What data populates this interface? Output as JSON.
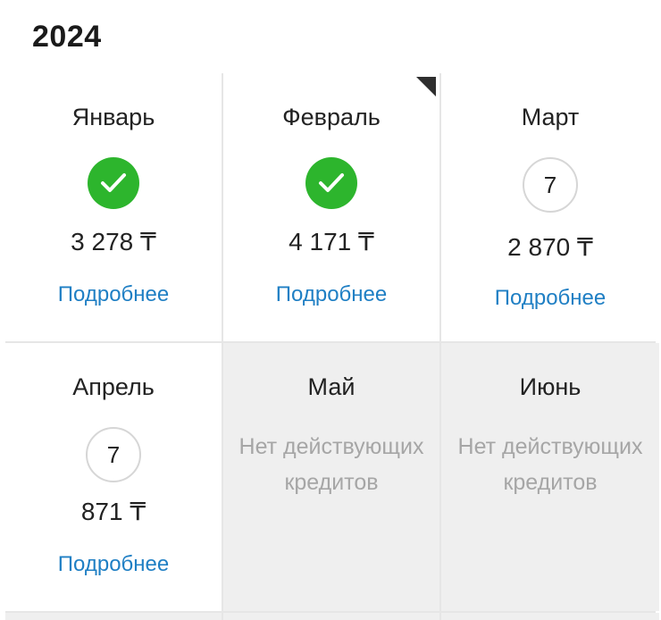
{
  "year": "2024",
  "months": [
    {
      "name": "Январь",
      "status": "paid",
      "amount": "3 278 ₸",
      "link": "Подробнее"
    },
    {
      "name": "Февраль",
      "status": "paid",
      "amount": "4 171 ₸",
      "link": "Подробнее"
    },
    {
      "name": "Март",
      "status": "count",
      "count": "7",
      "amount": "2 870 ₸",
      "link": "Подробнее"
    },
    {
      "name": "Апрель",
      "status": "count",
      "count": "7",
      "amount": "871 ₸",
      "link": "Подробнее"
    },
    {
      "name": "Май",
      "status": "none",
      "message": "Нет действующих кредитов"
    },
    {
      "name": "Июнь",
      "status": "none",
      "message": "Нет действующих кредитов"
    }
  ],
  "colors": {
    "paid_green": "#2db52d",
    "link_blue": "#1f7fc4",
    "inactive_bg": "#efefef",
    "muted_text": "#a6a6a6"
  },
  "icons": {
    "paid": "check-circle-icon",
    "corner": "corner-flag-icon"
  }
}
